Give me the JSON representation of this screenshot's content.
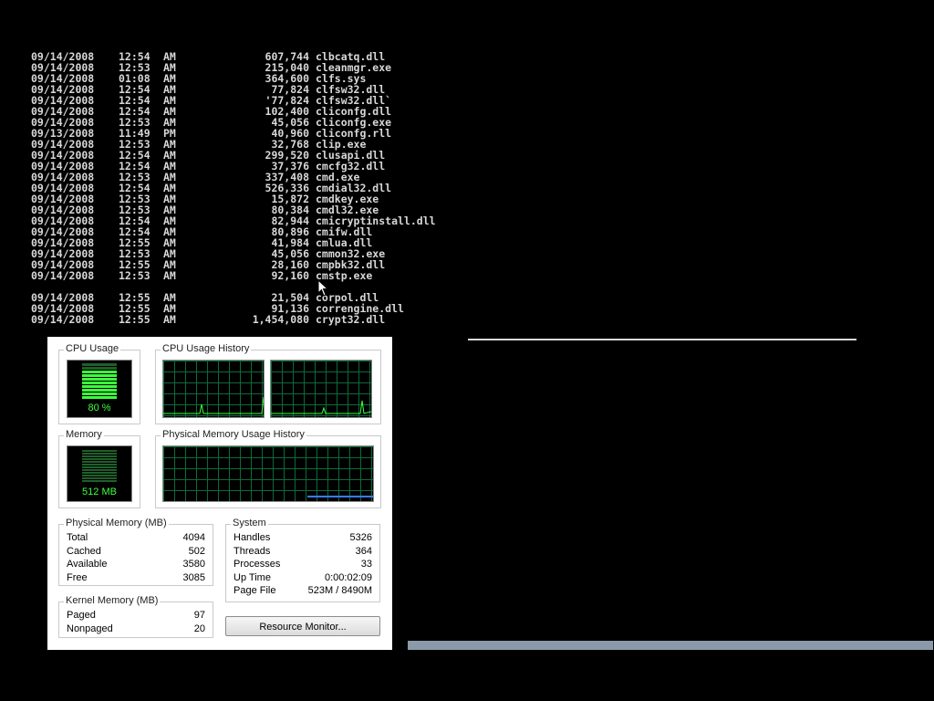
{
  "console": {
    "rows": [
      {
        "date": "09/14/2008",
        "time": "12:54",
        "ampm": "AM",
        "size": "607,744",
        "name": "clbcatq.dll"
      },
      {
        "date": "09/14/2008",
        "time": "12:53",
        "ampm": "AM",
        "size": "215,040",
        "name": "cleanmgr.exe"
      },
      {
        "date": "09/14/2008",
        "time": "01:08",
        "ampm": "AM",
        "size": "364,600",
        "name": "clfs.sys"
      },
      {
        "date": "09/14/2008",
        "time": "12:54",
        "ampm": "AM",
        "size": "77,824",
        "name": "clfsw32.dll"
      },
      {
        "date": "09/14/2008",
        "time": "12:54",
        "ampm": "AM",
        "size": "'77,824",
        "name": "clfsw32.dll`"
      },
      {
        "date": "09/14/2008",
        "time": "12:54",
        "ampm": "AM",
        "size": "102,400",
        "name": "cliconfg.dll"
      },
      {
        "date": "09/14/2008",
        "time": "12:53",
        "ampm": "AM",
        "size": "45,056",
        "name": "cliconfg.exe"
      },
      {
        "date": "09/13/2008",
        "time": "11:49",
        "ampm": "PM",
        "size": "40,960",
        "name": "cliconfg.rll"
      },
      {
        "date": "09/14/2008",
        "time": "12:53",
        "ampm": "AM",
        "size": "32,768",
        "name": "clip.exe"
      },
      {
        "date": "09/14/2008",
        "time": "12:54",
        "ampm": "AM",
        "size": "299,520",
        "name": "clusapi.dll"
      },
      {
        "date": "09/14/2008",
        "time": "12:54",
        "ampm": "AM",
        "size": "37,376",
        "name": "cmcfg32.dll"
      },
      {
        "date": "09/14/2008",
        "time": "12:53",
        "ampm": "AM",
        "size": "337,408",
        "name": "cmd.exe"
      },
      {
        "date": "09/14/2008",
        "time": "12:54",
        "ampm": "AM",
        "size": "526,336",
        "name": "cmdial32.dll"
      },
      {
        "date": "09/14/2008",
        "time": "12:53",
        "ampm": "AM",
        "size": "15,872",
        "name": "cmdkey.exe"
      },
      {
        "date": "09/14/2008",
        "time": "12:53",
        "ampm": "AM",
        "size": "80,384",
        "name": "cmdl32.exe"
      },
      {
        "date": "09/14/2008",
        "time": "12:54",
        "ampm": "AM",
        "size": "82,944",
        "name": "cmicryptinstall.dll"
      },
      {
        "date": "09/14/2008",
        "time": "12:54",
        "ampm": "AM",
        "size": "80,896",
        "name": "cmifw.dll"
      },
      {
        "date": "09/14/2008",
        "time": "12:55",
        "ampm": "AM",
        "size": "41,984",
        "name": "cmlua.dll"
      },
      {
        "date": "09/14/2008",
        "time": "12:53",
        "ampm": "AM",
        "size": "45,056",
        "name": "cmmon32.exe"
      },
      {
        "date": "09/14/2008",
        "time": "12:55",
        "ampm": "AM",
        "size": "28,160",
        "name": "cmpbk32.dll"
      },
      {
        "date": "09/14/2008",
        "time": "12:53",
        "ampm": "AM",
        "size": "92,160",
        "name": "cmstp.exe"
      }
    ],
    "rows_after_gap": [
      {
        "date": "09/14/2008",
        "time": "12:55",
        "ampm": "AM",
        "size": "21,504",
        "name": "corpol.dll"
      },
      {
        "date": "09/14/2008",
        "time": "12:55",
        "ampm": "AM",
        "size": "91,136",
        "name": "correngine.dll"
      },
      {
        "date": "09/14/2008",
        "time": "12:55",
        "ampm": "AM",
        "size": "1,454,080",
        "name": "crypt32.dll"
      }
    ]
  },
  "task_manager": {
    "cpu_usage": {
      "title": "CPU Usage",
      "value_label": "80 %",
      "level": 0.8
    },
    "cpu_history": {
      "title": "CPU Usage History"
    },
    "memory": {
      "title": "Memory",
      "value_label": "512 MB"
    },
    "memory_history": {
      "title": "Physical Memory Usage History"
    },
    "physical_memory": {
      "title": "Physical Memory (MB)",
      "rows": [
        {
          "label": "Total",
          "value": "4094"
        },
        {
          "label": "Cached",
          "value": "502"
        },
        {
          "label": "Available",
          "value": "3580"
        },
        {
          "label": "Free",
          "value": "3085"
        }
      ]
    },
    "kernel_memory": {
      "title": "Kernel Memory (MB)",
      "rows": [
        {
          "label": "Paged",
          "value": "97"
        },
        {
          "label": "Nonpaged",
          "value": "20"
        }
      ]
    },
    "system": {
      "title": "System",
      "rows": [
        {
          "label": "Handles",
          "value": "5326"
        },
        {
          "label": "Threads",
          "value": "364"
        },
        {
          "label": "Processes",
          "value": "33"
        },
        {
          "label": "Up Time",
          "value": "0:00:02:09"
        },
        {
          "label": "Page File",
          "value": "523M / 8490M"
        }
      ]
    },
    "resource_monitor_button": "Resource Monitor...",
    "colors": {
      "graph_line": "#3dff3d",
      "memory_line": "#3a7bff",
      "grid": "#0a6b3a"
    }
  }
}
